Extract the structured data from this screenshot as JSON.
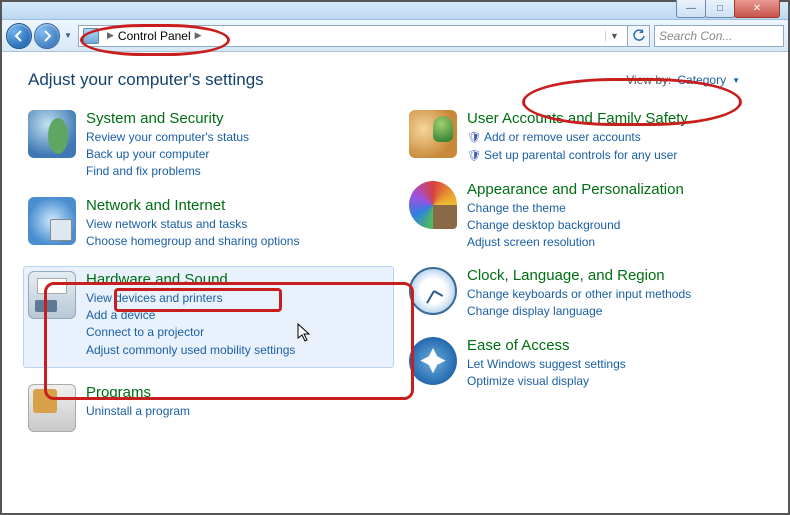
{
  "window": {
    "min": "—",
    "max": "□",
    "close": "✕"
  },
  "breadcrumb": {
    "root_icon": "control-panel",
    "item1": "Control Panel"
  },
  "search": {
    "placeholder": "Search Con..."
  },
  "heading": "Adjust your computer's settings",
  "viewby": {
    "label": "View by:",
    "value": "Category"
  },
  "left_categories": [
    {
      "id": "system-security",
      "title": "System and Security",
      "links": [
        "Review your computer's status",
        "Back up your computer",
        "Find and fix problems"
      ]
    },
    {
      "id": "network-internet",
      "title": "Network and Internet",
      "links": [
        "View network status and tasks",
        "Choose homegroup and sharing options"
      ]
    },
    {
      "id": "hardware-sound",
      "title": "Hardware and Sound",
      "hover": true,
      "links": [
        "View devices and printers",
        "Add a device",
        "Connect to a projector",
        "Adjust commonly used mobility settings"
      ]
    },
    {
      "id": "programs",
      "title": "Programs",
      "links": [
        "Uninstall a program"
      ]
    }
  ],
  "right_categories": [
    {
      "id": "user-accounts",
      "title": "User Accounts and Family Safety",
      "links": [
        {
          "text": "Add or remove user accounts",
          "shield": true
        },
        {
          "text": "Set up parental controls for any user",
          "shield": true
        }
      ]
    },
    {
      "id": "appearance",
      "title": "Appearance and Personalization",
      "links": [
        "Change the theme",
        "Change desktop background",
        "Adjust screen resolution"
      ]
    },
    {
      "id": "clock-language-region",
      "title": "Clock, Language, and Region",
      "links": [
        "Change keyboards or other input methods",
        "Change display language"
      ]
    },
    {
      "id": "ease-of-access",
      "title": "Ease of Access",
      "links": [
        "Let Windows suggest settings",
        "Optimize visual display"
      ]
    }
  ]
}
